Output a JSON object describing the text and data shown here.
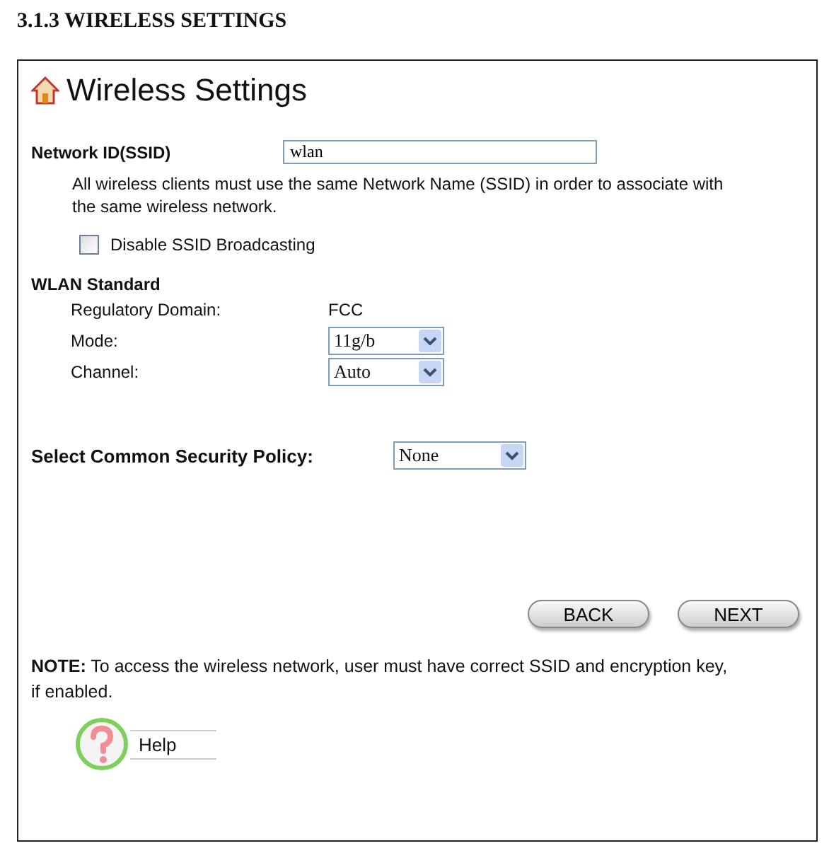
{
  "heading": "3.1.3 WIRELESS SETTINGS",
  "page": {
    "title": "Wireless Settings",
    "ssid": {
      "label": "Network ID(SSID)",
      "value": "wlan",
      "hint": "All wireless clients must use the same Network Name (SSID) in order to associate with the same wireless network."
    },
    "disable_broadcast": {
      "label": "Disable SSID Broadcasting",
      "checked": false
    },
    "wlan_standard": {
      "title": "WLAN Standard",
      "rows": [
        {
          "kind": "text",
          "label": "Regulatory Domain:",
          "value": "FCC"
        },
        {
          "kind": "select",
          "label": "Mode:",
          "value": "11g/b"
        },
        {
          "kind": "select",
          "label": "Channel:",
          "value": "Auto"
        }
      ]
    },
    "security": {
      "label": "Select Common Security Policy:",
      "value": "None"
    },
    "buttons": [
      "BACK",
      "NEXT"
    ],
    "note": "**NOTE:** To access the wireless network, user must have correct SSID and encryption key, if enabled.",
    "help": "Help"
  }
}
